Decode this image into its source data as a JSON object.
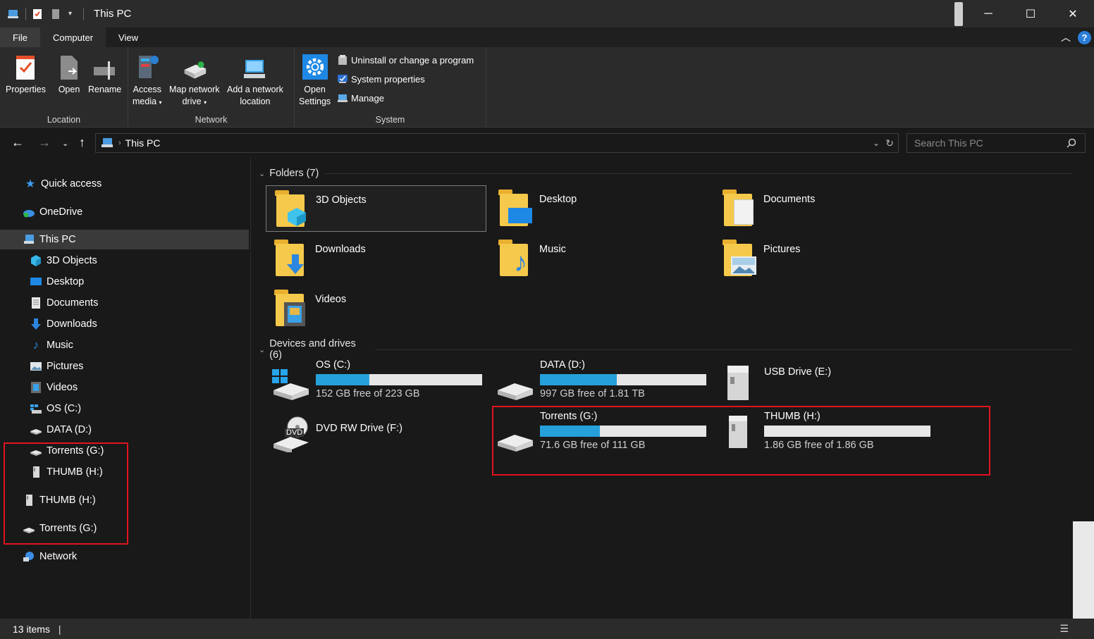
{
  "window": {
    "title": "This PC",
    "controls": {
      "minimize": "─",
      "maximize": "☐",
      "close": "✕"
    }
  },
  "ribbon_tabs": [
    "File",
    "Computer",
    "View"
  ],
  "ribbon": {
    "location": {
      "label": "Location",
      "buttons": [
        "Properties",
        "Open",
        "Rename"
      ]
    },
    "network": {
      "label": "Network",
      "access_media": [
        "Access",
        "media"
      ],
      "map_drive": [
        "Map network",
        "drive"
      ],
      "add_location": [
        "Add a network",
        "location"
      ]
    },
    "system": {
      "label": "System",
      "open_settings": [
        "Open",
        "Settings"
      ],
      "uninstall": "Uninstall or change a program",
      "system_properties": "System properties",
      "manage": "Manage"
    }
  },
  "address": {
    "path": "This PC",
    "search_placeholder": "Search This PC"
  },
  "sidebar": {
    "items": [
      {
        "label": "Quick access",
        "icon": "star-icon"
      },
      {
        "label": "OneDrive",
        "icon": "cloud-icon"
      },
      {
        "label": "This PC",
        "icon": "computer-icon"
      },
      {
        "label": "3D Objects",
        "icon": "cube-icon"
      },
      {
        "label": "Desktop",
        "icon": "desktop-icon"
      },
      {
        "label": "Documents",
        "icon": "document-icon"
      },
      {
        "label": "Downloads",
        "icon": "download-icon"
      },
      {
        "label": "Music",
        "icon": "music-icon"
      },
      {
        "label": "Pictures",
        "icon": "pictures-icon"
      },
      {
        "label": "Videos",
        "icon": "videos-icon"
      },
      {
        "label": "OS (C:)",
        "icon": "windows-drive-icon"
      },
      {
        "label": "DATA (D:)",
        "icon": "drive-icon"
      },
      {
        "label": "Torrents (G:)",
        "icon": "drive-icon"
      },
      {
        "label": "THUMB (H:)",
        "icon": "usb-icon"
      },
      {
        "label": "THUMB (H:)",
        "icon": "usb-icon"
      },
      {
        "label": "Torrents (G:)",
        "icon": "drive-icon"
      },
      {
        "label": "Network",
        "icon": "network-icon"
      }
    ]
  },
  "folders": {
    "header": "Folders (7)",
    "items": [
      "3D Objects",
      "Desktop",
      "Documents",
      "Downloads",
      "Music",
      "Pictures",
      "Videos"
    ]
  },
  "drives": {
    "header": "Devices and drives (6)",
    "items": [
      {
        "name": "OS (C:)",
        "free": "152 GB free of 223 GB",
        "used_fraction": 0.32
      },
      {
        "name": "DATA (D:)",
        "free": "997 GB free of 1.81 TB",
        "used_fraction": 0.46
      },
      {
        "name": "USB Drive (E:)"
      },
      {
        "name": "DVD RW Drive (F:)",
        "disc_label": "DVD"
      },
      {
        "name": "Torrents (G:)",
        "free": "71.6 GB free of 111 GB",
        "used_fraction": 0.36
      },
      {
        "name": "THUMB (H:)",
        "free": "1.86 GB free of 1.86 GB",
        "used_fraction": 0.0
      }
    ]
  },
  "status": {
    "items": "13 items",
    "separator": "|"
  },
  "colors": {
    "accent": "#26a0da",
    "highlight_box": "#e0141e",
    "background": "#191919"
  }
}
